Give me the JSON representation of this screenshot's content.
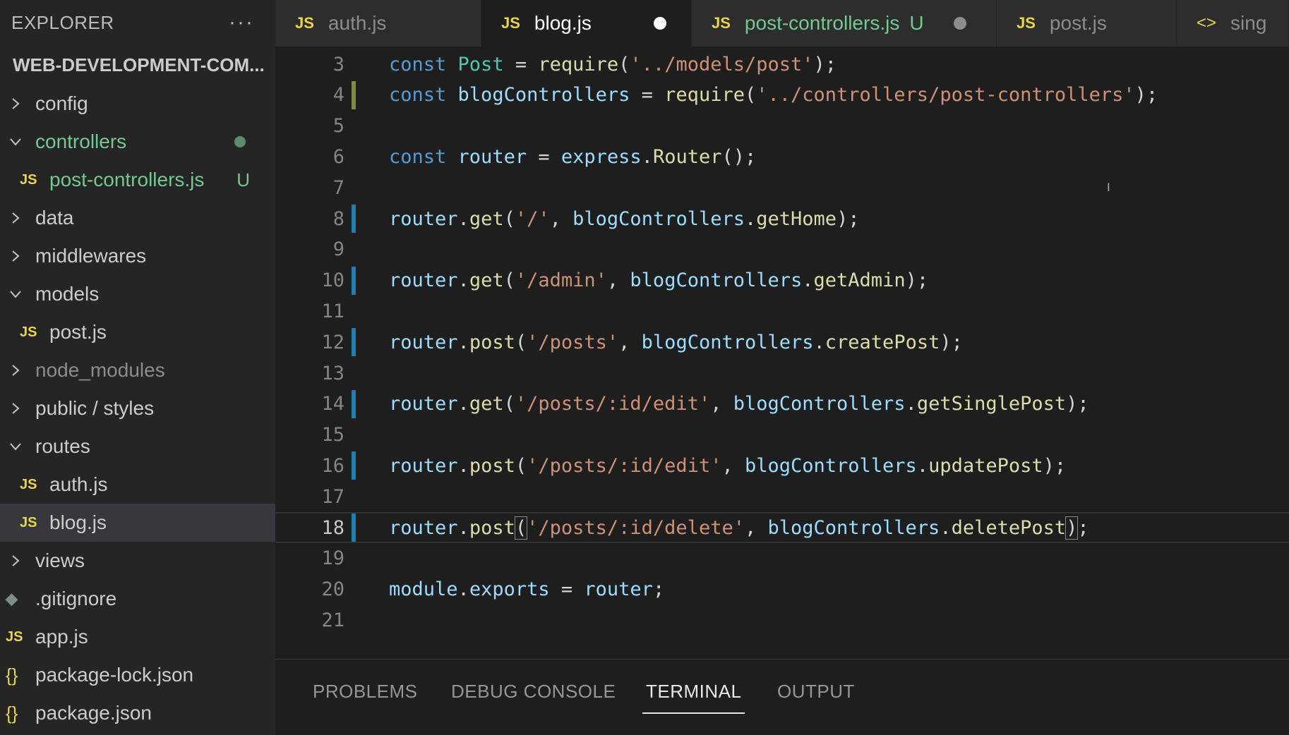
{
  "explorer": {
    "title": "EXPLORER",
    "more": "···",
    "project": "WEB-DEVELOPMENT-COM...",
    "items": [
      {
        "label": "config"
      },
      {
        "label": "controllers"
      },
      {
        "label": "post-controllers.js",
        "badge": "U"
      },
      {
        "label": "data"
      },
      {
        "label": "middlewares"
      },
      {
        "label": "models"
      },
      {
        "label": "post.js"
      },
      {
        "label": "node_modules"
      },
      {
        "label": "public / styles"
      },
      {
        "label": "routes"
      },
      {
        "label": "auth.js"
      },
      {
        "label": "blog.js"
      },
      {
        "label": "views"
      },
      {
        "label": ".gitignore"
      },
      {
        "label": "app.js"
      },
      {
        "label": "package-lock.json"
      },
      {
        "label": "package.json"
      }
    ],
    "js_icon": "JS",
    "json_icon": "{}",
    "git_icon": "◆"
  },
  "tabs": [
    {
      "icon": "JS",
      "label": "auth.js"
    },
    {
      "icon": "JS",
      "label": "blog.js"
    },
    {
      "icon": "JS",
      "label": "post-controllers.js",
      "badge": "U"
    },
    {
      "icon": "JS",
      "label": "post.js"
    },
    {
      "icon": "<>",
      "label": "sing"
    }
  ],
  "editor": {
    "lines": [
      {
        "n": "3",
        "tokens": [
          "const",
          " ",
          "Post",
          " = ",
          "require",
          "(",
          "'../models/post'",
          ");"
        ]
      },
      {
        "n": "4",
        "tokens": [
          "const",
          " ",
          "blogControllers",
          " = ",
          "require",
          "(",
          "'../controllers/post-controllers'",
          ");"
        ]
      },
      {
        "n": "5",
        "tokens": []
      },
      {
        "n": "6",
        "tokens": [
          "const",
          " ",
          "router",
          " = ",
          "express",
          ".",
          "Router",
          "();"
        ]
      },
      {
        "n": "7",
        "tokens": []
      },
      {
        "n": "8",
        "tokens": [
          "router",
          ".",
          "get",
          "(",
          "'/'",
          ", ",
          "blogControllers",
          ".",
          "getHome",
          ");"
        ]
      },
      {
        "n": "9",
        "tokens": []
      },
      {
        "n": "10",
        "tokens": [
          "router",
          ".",
          "get",
          "(",
          "'/admin'",
          ", ",
          "blogControllers",
          ".",
          "getAdmin",
          ");"
        ]
      },
      {
        "n": "11",
        "tokens": []
      },
      {
        "n": "12",
        "tokens": [
          "router",
          ".",
          "post",
          "(",
          "'/posts'",
          ", ",
          "blogControllers",
          ".",
          "createPost",
          ");"
        ]
      },
      {
        "n": "13",
        "tokens": []
      },
      {
        "n": "14",
        "tokens": [
          "router",
          ".",
          "get",
          "(",
          "'/posts/:id/edit'",
          ", ",
          "blogControllers",
          ".",
          "getSinglePost",
          ");"
        ]
      },
      {
        "n": "15",
        "tokens": []
      },
      {
        "n": "16",
        "tokens": [
          "router",
          ".",
          "post",
          "(",
          "'/posts/:id/edit'",
          ", ",
          "blogControllers",
          ".",
          "updatePost",
          ");"
        ]
      },
      {
        "n": "17",
        "tokens": []
      },
      {
        "n": "18",
        "tokens": [
          "router",
          ".",
          "post",
          "(",
          "'/posts/:id/delete'",
          ", ",
          "blogControllers",
          ".",
          "deletePost",
          ")",
          ";"
        ]
      },
      {
        "n": "19",
        "tokens": []
      },
      {
        "n": "20",
        "tokens": [
          "module",
          ".",
          "exports",
          " = ",
          "router",
          ";"
        ]
      },
      {
        "n": "21",
        "tokens": []
      }
    ]
  },
  "panel": {
    "tabs": [
      "PROBLEMS",
      "DEBUG CONSOLE",
      "TERMINAL",
      "OUTPUT"
    ]
  },
  "colors": {
    "background": "#1e1e1e",
    "sidebar": "#252526",
    "keyword": "#569cd6",
    "variable": "#9cdcfe",
    "class": "#4ec9b0",
    "function": "#dcdcaa",
    "string": "#ce9178",
    "git_untracked": "#73c991",
    "js_icon": "#e8d44d"
  }
}
